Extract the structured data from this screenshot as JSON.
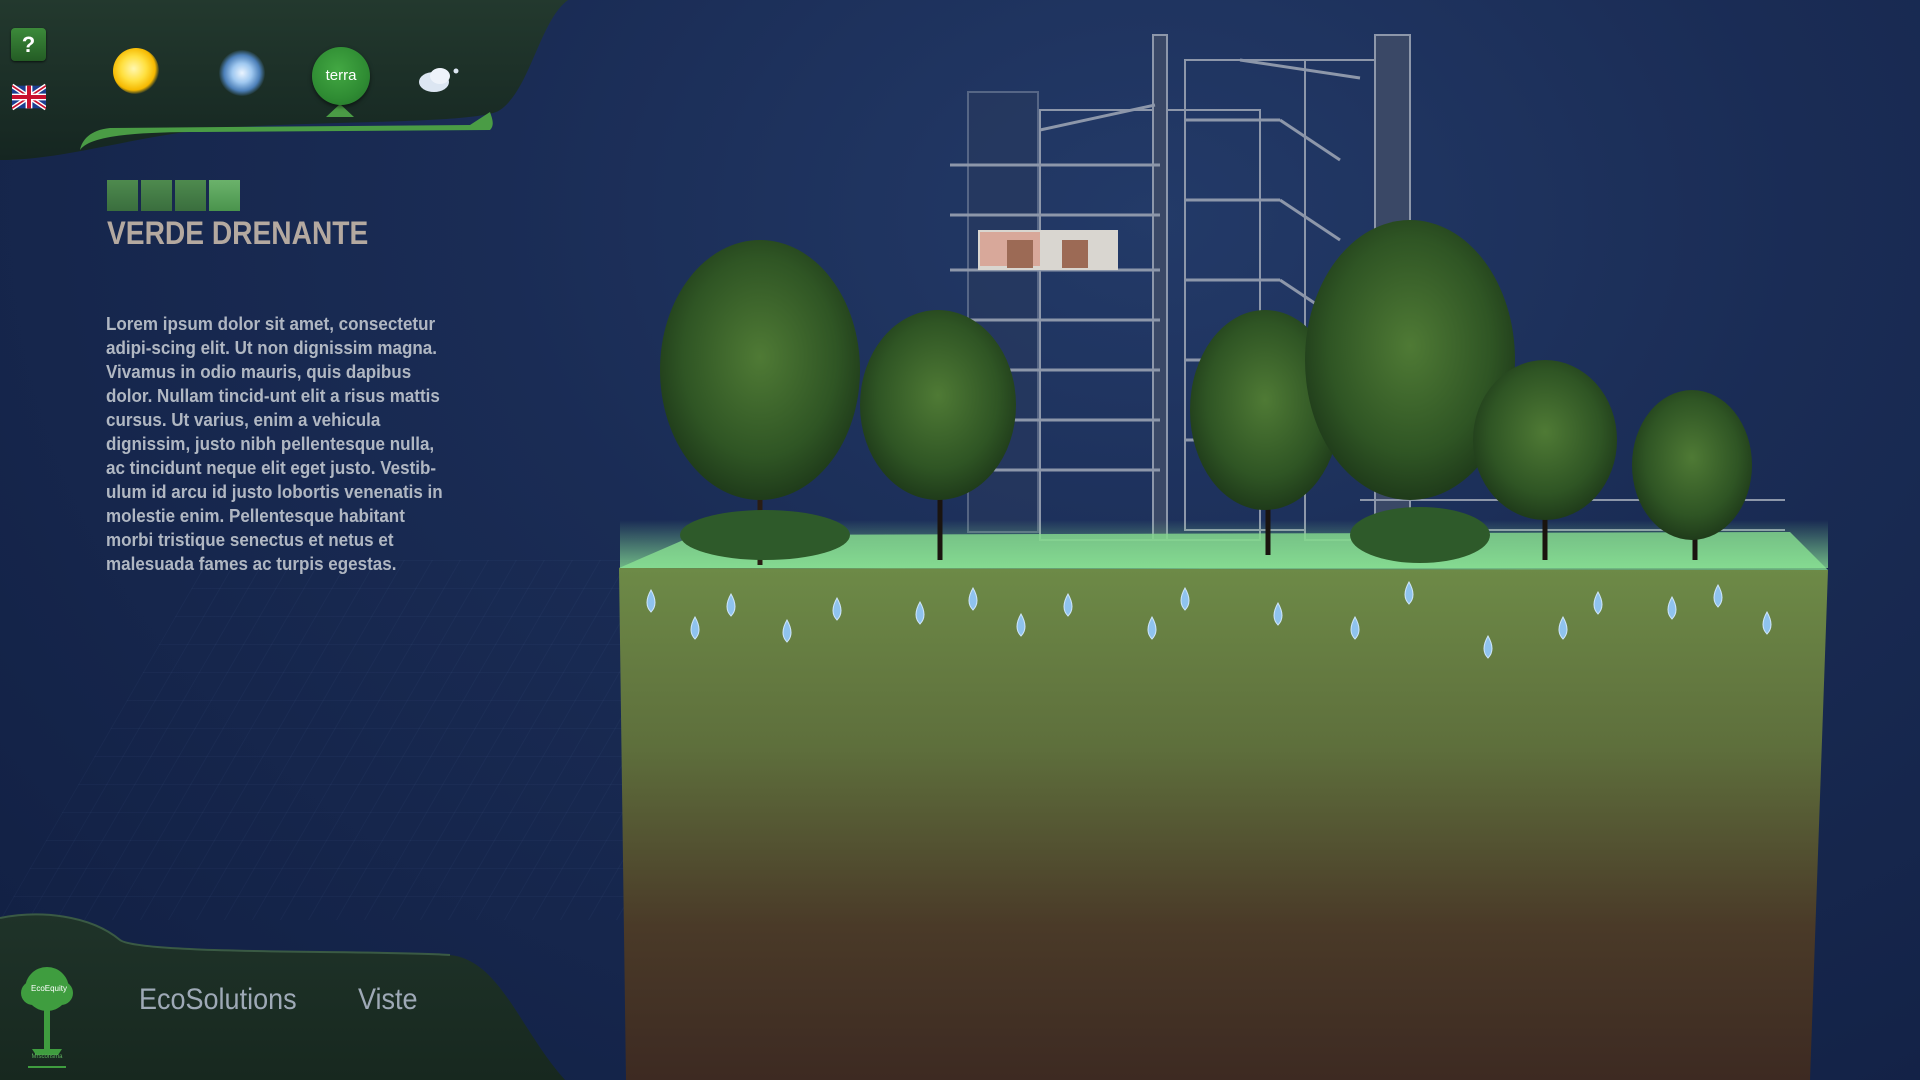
{
  "toolbar": {
    "help_label": "?",
    "language_flag": "uk-flag-icon",
    "modes": [
      {
        "name": "sun",
        "icon": "sun-icon"
      },
      {
        "name": "wind",
        "icon": "wind-icon"
      },
      {
        "name": "terra",
        "label": "terra",
        "selected": true
      },
      {
        "name": "cloud",
        "icon": "cloud-icon"
      }
    ]
  },
  "info": {
    "title": "VERDE DRENANTE",
    "description": "Lorem ipsum dolor sit amet, consectetur adipi-scing elit. Ut non dignissim magna. Vivamus in odio mauris, quis dapibus dolor. Nullam tincid-unt elit a risus mattis cursus. Ut varius, enim a vehicula dignissim, justo nibh pellentesque nulla, ac tincidunt neque elit eget justo. Vestib-ulum id arcu id justo lobortis venenatis in molestie enim. Pellentesque habitant morbi tristique senectus et netus et malesuada fames ac turpis egestas."
  },
  "footer": {
    "logo_text": "EcoEquity",
    "logo_subtext": "Mrsconsma",
    "nav": [
      "EcoSolutions",
      "Viste"
    ]
  },
  "colors": {
    "background": "#1a2c55",
    "accent_green": "#2f8c33",
    "panel": "#1b2d27",
    "soil_top": "#6f8a48",
    "soil_bottom": "#3f2a22",
    "water_drop": "#8fc3ee"
  }
}
